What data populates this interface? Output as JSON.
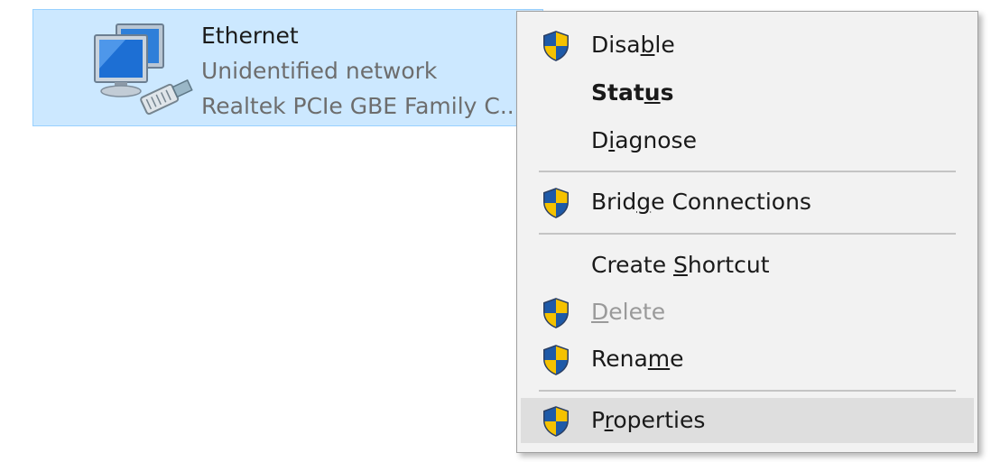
{
  "adapter": {
    "name": "Ethernet",
    "status": "Unidentified network",
    "device": "Realtek PCIe GBE Family C..."
  },
  "context_menu": {
    "items": [
      {
        "label": "Disable",
        "icon": "uac-shield-icon",
        "bold": false,
        "enabled": true,
        "access_key": "b"
      },
      {
        "label": "Status",
        "icon": "",
        "bold": true,
        "enabled": true,
        "access_key": "u"
      },
      {
        "label": "Diagnose",
        "icon": "",
        "bold": false,
        "enabled": true,
        "access_key": "i"
      },
      {
        "label": "Bridge Connections",
        "icon": "uac-shield-icon",
        "bold": false,
        "enabled": true,
        "access_key": "g"
      },
      {
        "label": "Create Shortcut",
        "icon": "",
        "bold": false,
        "enabled": true,
        "access_key": "S"
      },
      {
        "label": "Delete",
        "icon": "uac-shield-icon",
        "bold": false,
        "enabled": false,
        "access_key": "D"
      },
      {
        "label": "Rename",
        "icon": "uac-shield-icon",
        "bold": false,
        "enabled": true,
        "access_key": "m"
      },
      {
        "label": "Properties",
        "icon": "uac-shield-icon",
        "bold": false,
        "enabled": true,
        "access_key": "r",
        "highlighted": true
      }
    ]
  },
  "colors": {
    "selection_fill": "#cce8ff",
    "selection_border": "#99d1ff",
    "menu_background": "#f2f2f2",
    "menu_highlight": "#dedede",
    "shield_blue": "#1e5aa8",
    "shield_yellow": "#f5c200"
  }
}
